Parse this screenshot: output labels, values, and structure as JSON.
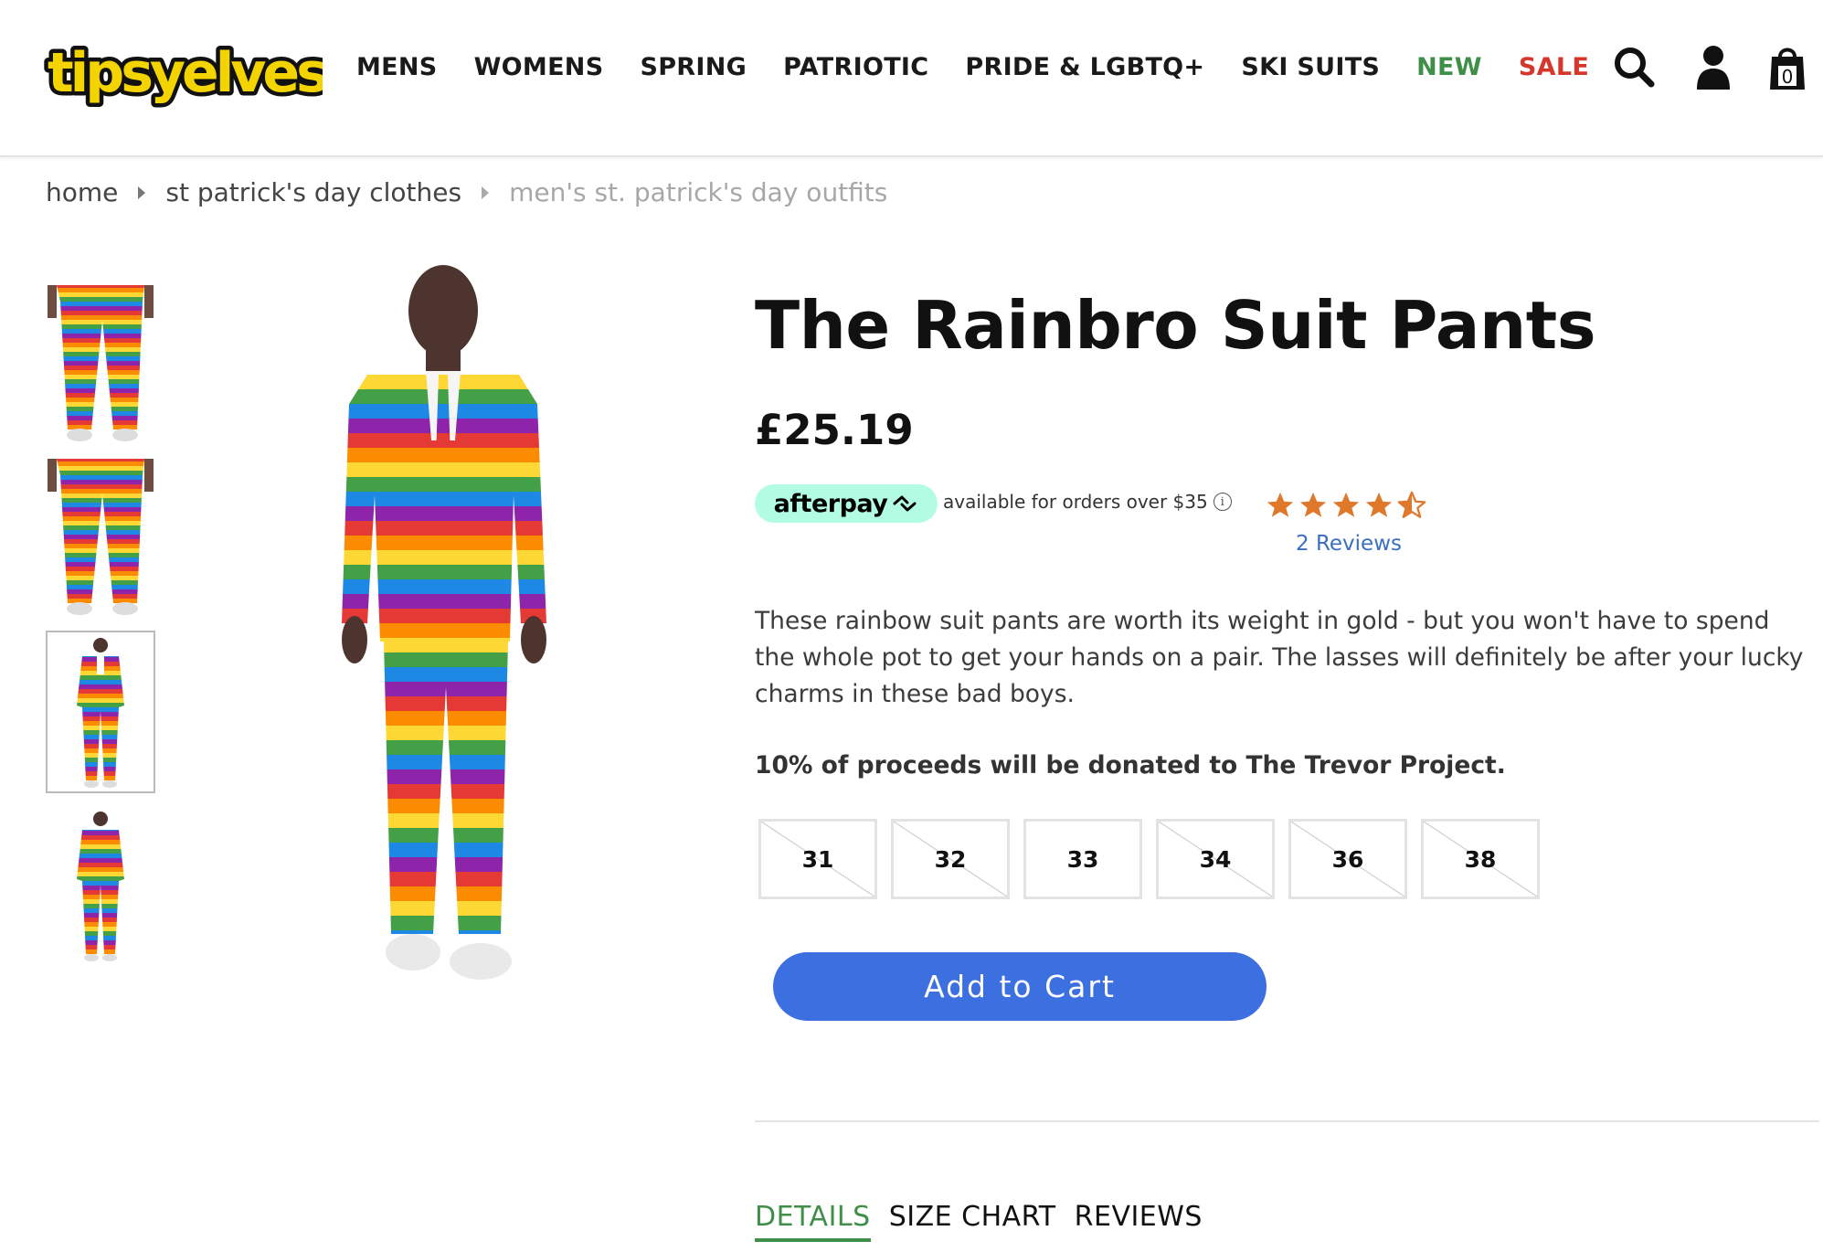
{
  "brand": {
    "logo_text": "tipsyelves",
    "logo_green": "#3f8f49",
    "logo_yellow": "#f3d400"
  },
  "nav": {
    "items": [
      {
        "label": "MENS"
      },
      {
        "label": "WOMENS"
      },
      {
        "label": "SPRING"
      },
      {
        "label": "PATRIOTIC"
      },
      {
        "label": "PRIDE & LGBTQ+"
      },
      {
        "label": "SKI SUITS"
      },
      {
        "label": "NEW",
        "color": "#3f8f49"
      },
      {
        "label": "SALE",
        "color": "#d6372c"
      }
    ]
  },
  "header": {
    "icons": [
      "search-icon",
      "account-icon",
      "cart-icon"
    ],
    "cart_count": "0"
  },
  "breadcrumb": {
    "items": [
      "home",
      "st patrick's day clothes",
      "men's st. patrick's day outfits"
    ]
  },
  "gallery": {
    "thumbnails": [
      {
        "name": "thumb-pants-front",
        "active": false
      },
      {
        "name": "thumb-pants-back",
        "active": false
      },
      {
        "name": "thumb-full-suit-front",
        "active": true
      },
      {
        "name": "thumb-full-suit-back",
        "active": false
      }
    ]
  },
  "product": {
    "title": "The Rainbro Suit Pants",
    "price": "£25.19",
    "afterpay_label": "afterpay",
    "afterpay_text": "available for orders over $35",
    "afterpay_color": "#b2fce4",
    "rating": 4.5,
    "rating_max": 5,
    "star_color": "#e0782c",
    "reviews_label": "2 Reviews",
    "description": "These rainbow suit pants are worth its weight in gold - but you won't have to spend the whole pot to get your hands on a pair. The lasses will definitely be after your lucky charms in these bad boys.",
    "donation": "10% of proceeds will be donated to The Trevor Project.",
    "sizes": [
      {
        "label": "31",
        "available": false
      },
      {
        "label": "32",
        "available": false
      },
      {
        "label": "33",
        "available": true
      },
      {
        "label": "34",
        "available": false
      },
      {
        "label": "36",
        "available": false
      },
      {
        "label": "38",
        "available": false
      }
    ],
    "add_to_cart_label": "Add to Cart",
    "button_color": "#3c6fe0"
  },
  "tabs": {
    "items": [
      {
        "label": "DETAILS",
        "active": true
      },
      {
        "label": "SIZE CHART",
        "active": false
      },
      {
        "label": "REVIEWS",
        "active": false
      }
    ]
  }
}
